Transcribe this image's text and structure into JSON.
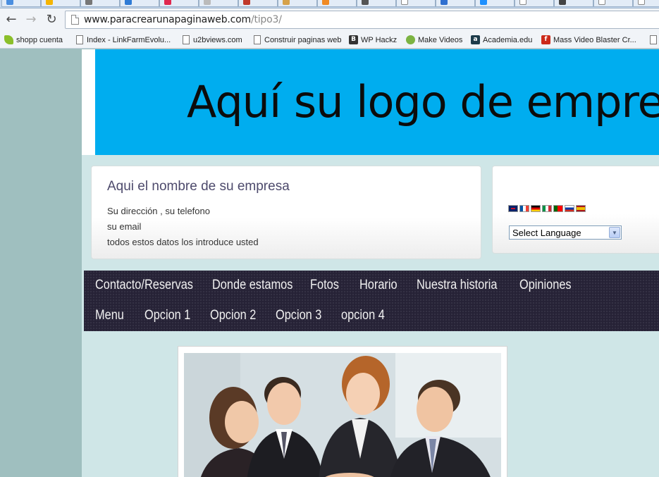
{
  "browser": {
    "url_host": "www.paracrearunapaginaweb.com",
    "url_path": "/tipo3/",
    "bookmarks": [
      {
        "label": "shopp cuenta",
        "icon": "leaf-icon",
        "color": "#8bbf2a"
      },
      {
        "label": "Index - LinkFarmEvolu...",
        "icon": "page-icon"
      },
      {
        "label": "u2bviews.com",
        "icon": "page-icon"
      },
      {
        "label": "Construir paginas web",
        "icon": "page-icon"
      },
      {
        "label": "WP Hackz",
        "icon": "b-icon",
        "color": "#333333"
      },
      {
        "label": "Make Videos",
        "icon": "globe-icon",
        "color": "#7cb342"
      },
      {
        "label": "Academia.edu",
        "icon": "a-icon",
        "color": "#1c3b4a"
      },
      {
        "label": "Mass Video Blaster Cr...",
        "icon": "f-icon",
        "color": "#cc2a1a"
      }
    ]
  },
  "header": {
    "logo_text": "Aquí su logo de empresa",
    "logo_bg": "#00adef"
  },
  "company": {
    "name": "Aqui el nombre de su empresa",
    "address": "Su dirección , su telefono",
    "email": "su email",
    "note": "todos estos datos los introduce usted"
  },
  "language": {
    "select_label": "Select Language",
    "flags": [
      "uk-flag-icon",
      "france-flag-icon",
      "germany-flag-icon",
      "italy-flag-icon",
      "portugal-flag-icon",
      "russia-flag-icon",
      "spain-flag-icon"
    ]
  },
  "nav": {
    "row1": [
      "Contacto/Reservas",
      "Donde estamos",
      "Fotos",
      "Horario",
      "Nuestra historia",
      "Opiniones"
    ],
    "row2": [
      "Menu",
      "Opcion 1",
      "Opcion 2",
      "Opcion 3",
      "opcion 4"
    ]
  },
  "colors": {
    "page_bg": "#9fbfbf",
    "content_bg": "#cfe6e7",
    "nav_bg": "#262236",
    "company_title": "#4d4a6c"
  }
}
